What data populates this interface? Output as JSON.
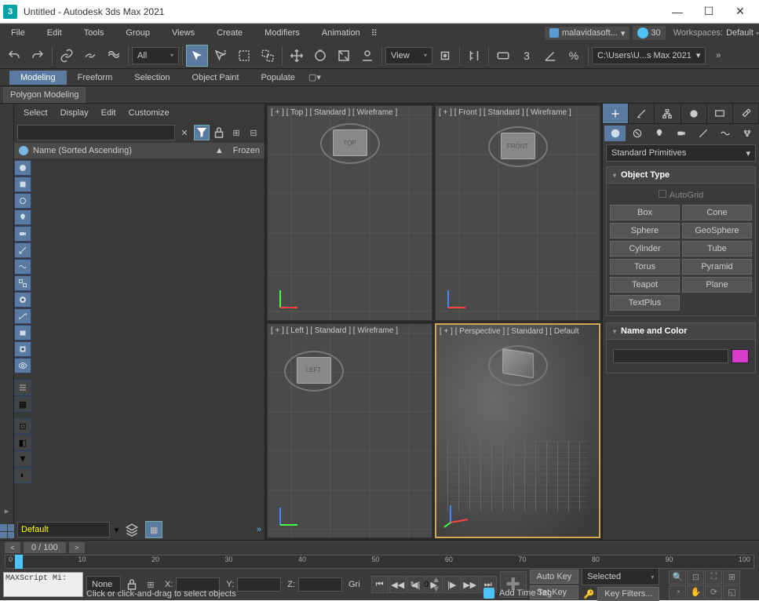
{
  "window": {
    "title": "Untitled - Autodesk 3ds Max 2021",
    "app_icon": "3"
  },
  "menubar": {
    "items": [
      "File",
      "Edit",
      "Tools",
      "Group",
      "Views",
      "Create",
      "Modifiers",
      "Animation"
    ],
    "user": "malavidasoft...",
    "clock": "30",
    "workspaces_label": "Workspaces:",
    "workspace": "Default"
  },
  "toolbar": {
    "selection_set": "All",
    "view_label": "View",
    "project_path": "C:\\Users\\U...s Max 2021"
  },
  "ribbon": {
    "tabs": [
      "Modeling",
      "Freeform",
      "Selection",
      "Object Paint",
      "Populate"
    ],
    "active": 0,
    "sub": "Polygon Modeling"
  },
  "outliner": {
    "menu": [
      "Select",
      "Display",
      "Edit",
      "Customize"
    ],
    "header_name": "Name (Sorted Ascending)",
    "header_sort": "▲",
    "header_frozen": "Frozen",
    "layer": "Default"
  },
  "viewports": {
    "v0": {
      "label": "[ + ] [ Top ] [ Standard ] [ Wireframe ]",
      "cube": "TOP"
    },
    "v1": {
      "label": "[ + ] [ Front ] [ Standard ] [ Wireframe ]",
      "cube": "FRONT"
    },
    "v2": {
      "label": "[ + ] [ Left ] [ Standard ] [ Wireframe ]",
      "cube": "LEFT"
    },
    "v3": {
      "label": "[ + ] [ Perspective ] [ Standard ] [ Default"
    }
  },
  "cmd": {
    "category": "Standard Primitives",
    "object_type_title": "Object Type",
    "autogrid": "AutoGrid",
    "primitives": [
      "Box",
      "Cone",
      "Sphere",
      "GeoSphere",
      "Cylinder",
      "Tube",
      "Torus",
      "Pyramid",
      "Teapot",
      "Plane",
      "TextPlus"
    ],
    "name_color_title": "Name and Color"
  },
  "time": {
    "slider": "0 / 100",
    "ticks": [
      "0",
      "10",
      "20",
      "30",
      "40",
      "50",
      "60",
      "70",
      "80",
      "90",
      "100"
    ]
  },
  "status": {
    "maxscript": "MAXScript Mi:",
    "none": "None",
    "x": "X:",
    "y": "Y:",
    "z": "Z:",
    "grid": "Gri",
    "prompt": "Click or click-and-drag to select objects",
    "add_tag": "Add Time Tag",
    "frame": "0",
    "autokey": "Auto Key",
    "setkey": "Set Key",
    "selected": "Selected",
    "keyfilters": "Key Filters..."
  }
}
